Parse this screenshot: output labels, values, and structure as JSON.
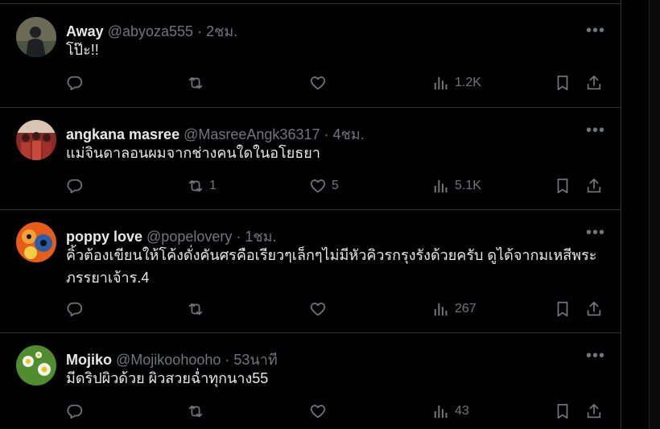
{
  "tweets": [
    {
      "name": "Away",
      "handle": "@abyoza555",
      "sep": "·",
      "time": "2ชม.",
      "text": "โป๊ะ!!",
      "replies": "",
      "retweets": "",
      "likes": "",
      "views": "1.2K",
      "avatar_colors": [
        "#6b6a55",
        "#1e2024"
      ]
    },
    {
      "name": "angkana masree",
      "handle": "@MasreeAngk36317",
      "sep": "·",
      "time": "4ชม.",
      "text": "แม่จินดาลอนผมจากช่างคนใดในอโยธยา",
      "replies": "",
      "retweets": "1",
      "likes": "5",
      "views": "5.1K",
      "avatar_colors": [
        "#8a2a26",
        "#d8c6b4"
      ]
    },
    {
      "name": "poppy love",
      "handle": "@popelovery",
      "sep": "·",
      "time": "1ชม.",
      "text": "คิ้วต้องเขียนให้โค้งดั่งคันศรคือเรียวๆเล็กๆไม่มีหัวคิวรกรุงรังด้วยครับ ดูได้จากมเหสีพระภรรยาเจ้าร.4",
      "replies": "",
      "retweets": "",
      "likes": "",
      "views": "267",
      "avatar_colors": [
        "#e85c1a",
        "#2c5ea8"
      ]
    },
    {
      "name": "Mojiko",
      "handle": "@Mojikoohooho",
      "sep": "·",
      "time": "53นาที",
      "text": "มีดริปผิวด้วย ผิวสวยฉ่ำทุกนาง55",
      "replies": "",
      "retweets": "",
      "likes": "",
      "views": "43",
      "avatar_colors": [
        "#4f8d2e",
        "#f4f4ee"
      ]
    }
  ],
  "icons": {
    "more": "more-icon",
    "reply": "reply-icon",
    "retweet": "retweet-icon",
    "like": "heart-icon",
    "views": "views-icon",
    "bookmark": "bookmark-icon",
    "share": "share-icon"
  },
  "colors": {
    "background": "#000000",
    "text": "#e7e9ea",
    "secondary": "#71767b",
    "divider": "#2f3336"
  }
}
